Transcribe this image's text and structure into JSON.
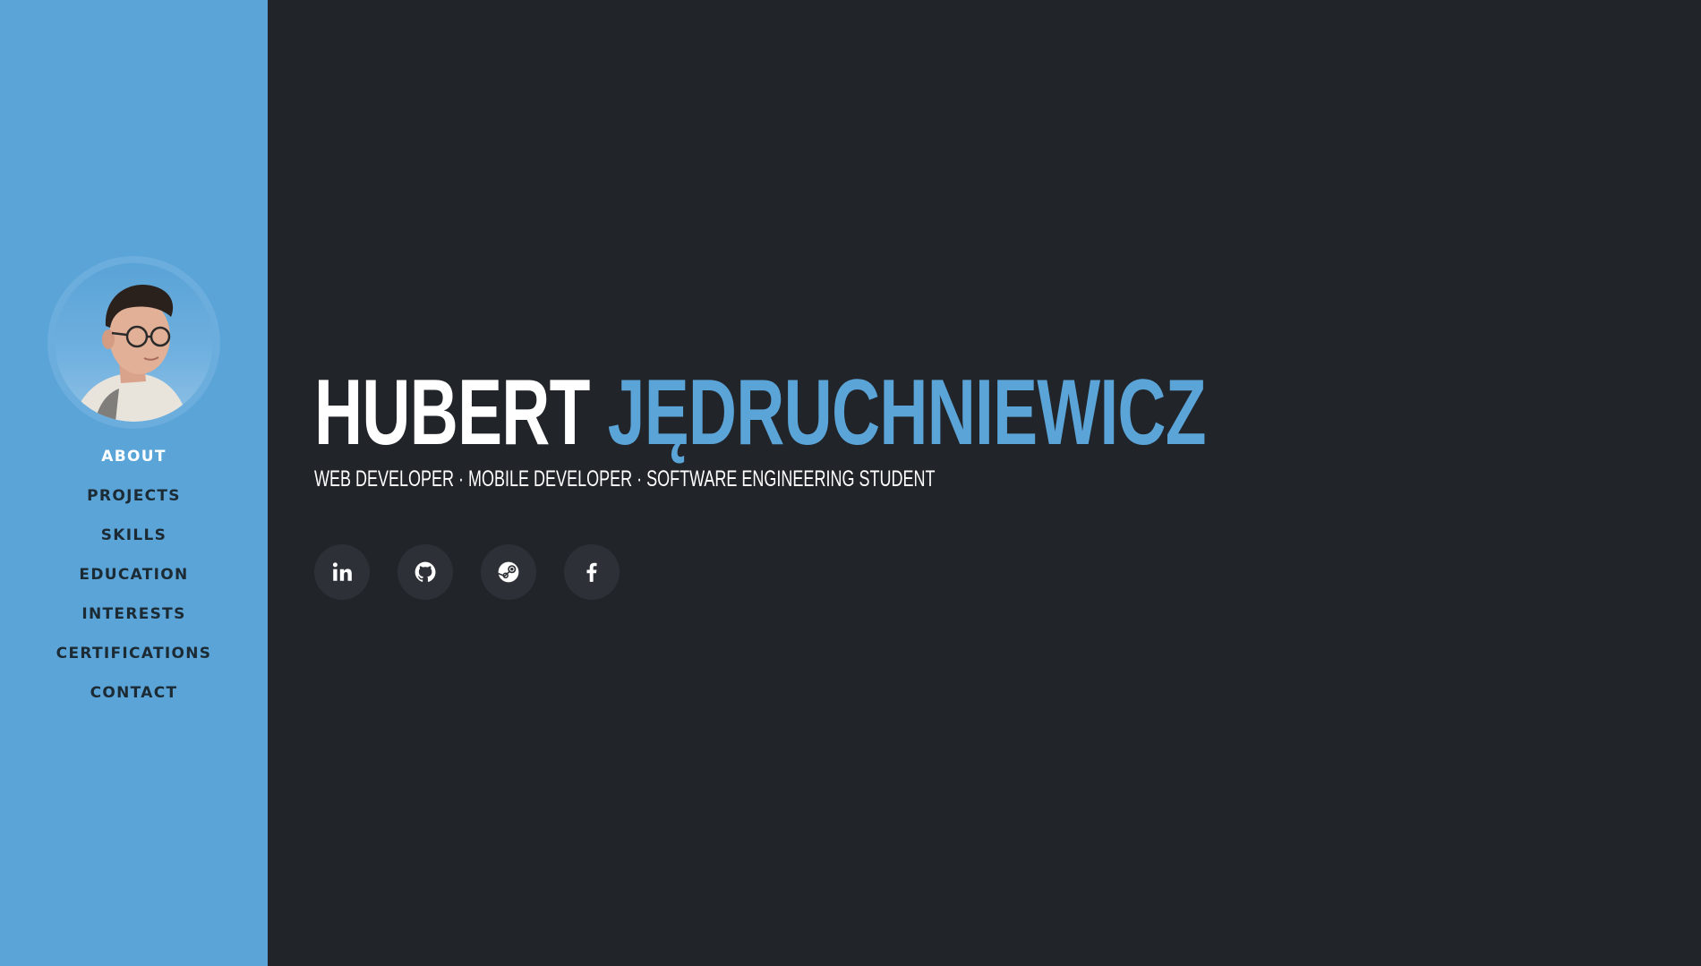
{
  "sidebar": {
    "avatar_icon": "profile-photo",
    "items": [
      {
        "label": "ABOUT",
        "active": true
      },
      {
        "label": "PROJECTS"
      },
      {
        "label": "SKILLS"
      },
      {
        "label": "EDUCATION"
      },
      {
        "label": "INTERESTS"
      },
      {
        "label": "CERTIFICATIONS"
      },
      {
        "label": "CONTACT"
      }
    ]
  },
  "hero": {
    "first_name": "HUBERT",
    "last_name": "JĘDRUCHNIEWICZ",
    "subtitle": "WEB DEVELOPER · MOBILE DEVELOPER · SOFTWARE ENGINEERING STUDENT"
  },
  "socials": [
    {
      "icon": "linkedin-icon"
    },
    {
      "icon": "github-icon"
    },
    {
      "icon": "steam-icon"
    },
    {
      "icon": "facebook-icon"
    }
  ],
  "colors": {
    "accent": "#5ba4d8",
    "background": "#212429",
    "nav_text": "#1c2a33",
    "social_bg": "#2d3036"
  }
}
